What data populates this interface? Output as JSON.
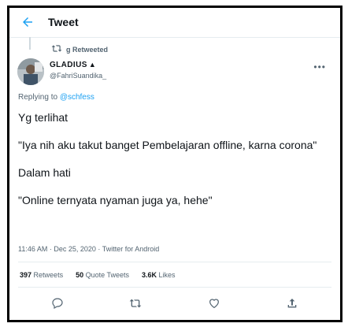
{
  "header": {
    "title": "Tweet"
  },
  "retweet": {
    "label": "g Retweeted"
  },
  "user": {
    "name": "GLADIUS",
    "handle": "@FahriSuandika_"
  },
  "reply": {
    "prefix": "Replying to",
    "to": "@schfess"
  },
  "tweet": {
    "line1": "Yg terlihat",
    "line2": "\"Iya nih aku takut banget Pembelajaran offline, karna corona\"",
    "line3": "Dalam hati",
    "line4": "\"Online ternyata nyaman juga ya, hehe\""
  },
  "meta": {
    "timestamp": "11:46 AM · Dec 25, 2020 · Twitter for Android"
  },
  "stats": {
    "retweets_count": "397",
    "retweets_label": "Retweets",
    "quotes_count": "50",
    "quotes_label": "Quote Tweets",
    "likes_count": "3.6K",
    "likes_label": "Likes"
  },
  "colors": {
    "accent": "#1da1f2",
    "muted": "#536471"
  }
}
